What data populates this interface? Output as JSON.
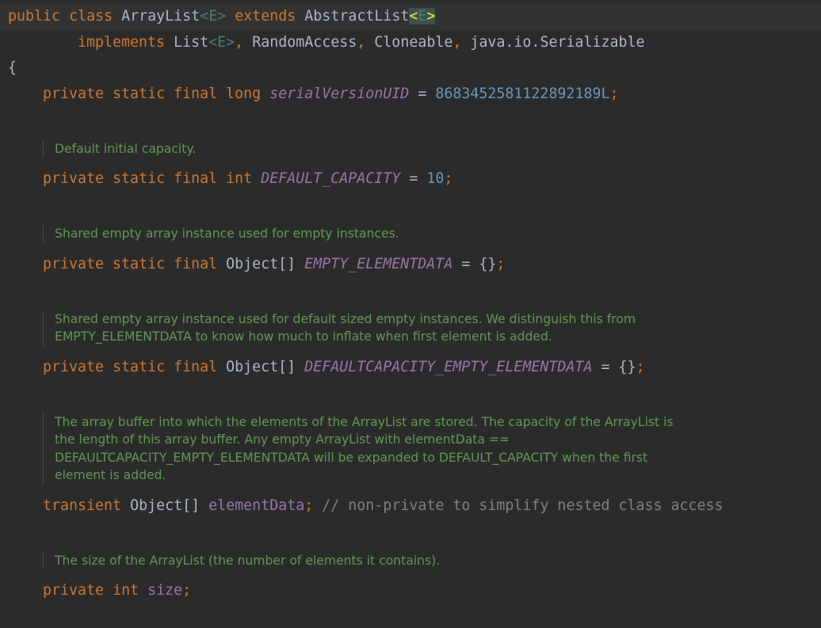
{
  "editor": {
    "class_decl": {
      "kw_public": "public",
      "kw_class": "class",
      "class_name": "ArrayList",
      "lt1": "<",
      "type_param1": "E",
      "gt1": ">",
      "kw_extends": "extends",
      "super_name": "AbstractList",
      "lt2": "<",
      "type_param2": "E",
      "gt2": ">"
    },
    "implements_line": {
      "kw_implements": "implements",
      "list_name": "List",
      "lt": "<",
      "type_param": "E",
      "gt": ">",
      "comma1": ",",
      "random_access": "RandomAccess",
      "comma2": ",",
      "cloneable": "Cloneable",
      "comma3": ",",
      "serializable": "java.io.Serializable"
    },
    "open_brace": "{",
    "serial": {
      "modifiers": "private static final",
      "type": "long",
      "name": "serialVersionUID",
      "eq": "=",
      "value": "8683452581122892189L",
      "semi": ";"
    },
    "doc_default_capacity": [
      "Default initial capacity."
    ],
    "default_capacity": {
      "modifiers": "private static final",
      "type": "int",
      "name": "DEFAULT_CAPACITY",
      "eq": "=",
      "value": "10",
      "semi": ";"
    },
    "doc_empty_elementdata": [
      "Shared empty array instance used for empty instances."
    ],
    "empty_elementdata": {
      "modifiers": "private static final",
      "type": "Object[]",
      "name": "EMPTY_ELEMENTDATA",
      "eq": "=",
      "value": "{}",
      "semi": ";"
    },
    "doc_defaultcapacity_empty": [
      "Shared empty array instance used for default sized empty instances. We distinguish this from",
      "EMPTY_ELEMENTDATA to know how much to inflate when first element is added."
    ],
    "defaultcapacity_empty": {
      "modifiers": "private static final",
      "type": "Object[]",
      "name": "DEFAULTCAPACITY_EMPTY_ELEMENTDATA",
      "eq": "=",
      "value": "{}",
      "semi": ";"
    },
    "doc_element_data": [
      "The array buffer into which the elements of the ArrayList are stored. The capacity of the ArrayList is",
      "the length of this array buffer. Any empty ArrayList with elementData ==",
      "DEFAULTCAPACITY_EMPTY_ELEMENTDATA will be expanded to DEFAULT_CAPACITY when the first",
      "element is added."
    ],
    "element_data": {
      "modifier": "transient",
      "type": "Object[]",
      "name": "elementData",
      "semi": ";",
      "comment": "// non-private to simplify nested class access"
    },
    "doc_size": [
      "The size of the ArrayList (the number of elements it contains)."
    ],
    "size_field": {
      "modifiers": "private",
      "type": "int",
      "name": "size",
      "semi": ";"
    }
  }
}
